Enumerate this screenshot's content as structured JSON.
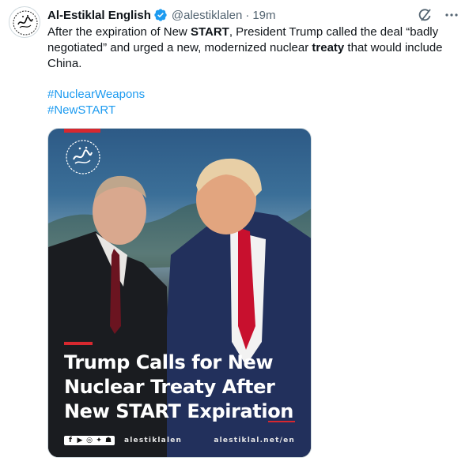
{
  "tweet": {
    "author_name": "Al-Estiklal English",
    "handle": "@alestiklalen",
    "separator": "·",
    "time": "19m",
    "text_parts": [
      "After the expiration of New ",
      "START",
      ", President Trump called the deal “badly negotiated” and urged a new, modernized nuclear ",
      "treaty",
      " that would include China."
    ],
    "hashtags": [
      "#NuclearWeapons",
      "#NewSTART"
    ]
  },
  "media": {
    "headline_lines": [
      "Trump Calls for New",
      "Nuclear Treaty After",
      "New START Expiration"
    ],
    "footer_handle": "alestiklalen",
    "footer_site": "alestiklal.net/en",
    "social_icons": [
      "facebook-icon",
      "youtube-icon",
      "instagram-icon",
      "twitter-icon",
      "snapchat-icon"
    ]
  },
  "colors": {
    "link": "#1d9bf0",
    "verified": "#1d9bf0",
    "accent_red": "#d7282f",
    "tie_red": "#c8102e"
  }
}
